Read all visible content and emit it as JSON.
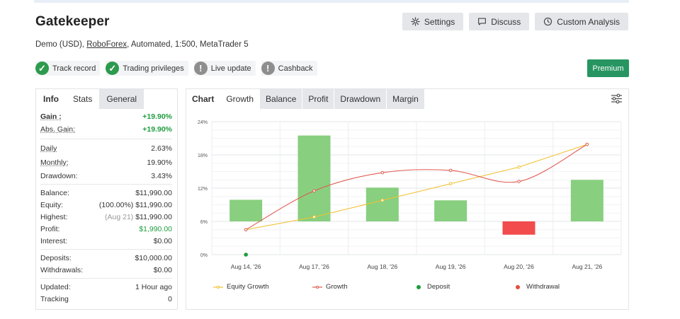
{
  "header": {
    "title": "Gatekeeper",
    "buttons": {
      "settings": "Settings",
      "discuss": "Discuss",
      "custom_analysis": "Custom Analysis"
    },
    "subtitle": {
      "prefix": "Demo (USD), ",
      "broker": "RoboForex",
      "suffix": ", Automated, 1:500, MetaTrader 5"
    }
  },
  "badges": [
    {
      "label": "Track record",
      "status": "ok",
      "icon": "check-icon"
    },
    {
      "label": "Trading privileges",
      "status": "ok",
      "icon": "check-icon"
    },
    {
      "label": "Live update",
      "status": "warn",
      "icon": "exclamation-icon"
    },
    {
      "label": "Cashback",
      "status": "warn",
      "icon": "exclamation-icon"
    }
  ],
  "premium_label": "Premium",
  "left_panel": {
    "tabs": [
      "Info",
      "Stats",
      "General"
    ],
    "stats": {
      "gain": {
        "label": "Gain :",
        "value": "+19.90%"
      },
      "abs_gain": {
        "label": "Abs. Gain:",
        "value": "+19.90%"
      },
      "daily": {
        "label": "Daily",
        "value": "2.63%"
      },
      "monthly": {
        "label": "Monthly:",
        "value": "19.90%"
      },
      "drawdown": {
        "label": "Drawdown:",
        "value": "3.43%"
      },
      "balance": {
        "label": "Balance:",
        "value": "$11,990.00"
      },
      "equity": {
        "label": "Equity:",
        "note": "(100.00%)",
        "value": "$11,990.00"
      },
      "highest": {
        "label": "Highest:",
        "note": "(Aug 21)",
        "value": "$11,990.00"
      },
      "profit": {
        "label": "Profit:",
        "value": "$1,990.00"
      },
      "interest": {
        "label": "Interest:",
        "value": "$0.00"
      },
      "deposits": {
        "label": "Deposits:",
        "value": "$10,000.00"
      },
      "withdrawals": {
        "label": "Withdrawals:",
        "value": "$0.00"
      },
      "updated": {
        "label": "Updated:",
        "value": "1 Hour ago"
      },
      "tracking": {
        "label": "Tracking",
        "value": "0"
      }
    }
  },
  "right_panel": {
    "tabs": [
      "Chart",
      "Growth",
      "Balance",
      "Profit",
      "Drawdown",
      "Margin"
    ]
  },
  "colors": {
    "bar_up": "#88cf7f",
    "bar_down": "#f24c4c",
    "growth_line": "#e05a4f",
    "equity_line": "#f1c232",
    "deposit": "#1d9e3b",
    "withdrawal": "#e74c3c",
    "accent_green": "#279561"
  },
  "chart_data": {
    "type": "bar",
    "categories": [
      "Aug 14, '26",
      "Aug 17, '26",
      "Aug 18, '26",
      "Aug 19, '26",
      "Aug 20, '26",
      "Aug 21, '26"
    ],
    "yticks": [
      "0%",
      "6%",
      "12%",
      "18%",
      "24%"
    ],
    "ylim": [
      0,
      24
    ],
    "bar_baseline": 6,
    "series": [
      {
        "name": "Equity Growth",
        "kind": "line",
        "values": [
          4.5,
          6.8,
          9.8,
          12.8,
          15.8,
          19.9
        ]
      },
      {
        "name": "Growth",
        "kind": "line",
        "values": [
          4.5,
          11.5,
          14.8,
          15.2,
          13.2,
          19.9
        ]
      },
      {
        "name": "Growth",
        "kind": "bar",
        "values": [
          3.9,
          15.5,
          6.1,
          3.8,
          -2.4,
          7.5
        ]
      },
      {
        "name": "Deposit",
        "kind": "point",
        "values": [
          0,
          null,
          null,
          null,
          null,
          null
        ]
      },
      {
        "name": "Withdrawal",
        "kind": "point",
        "values": [
          null,
          null,
          null,
          null,
          null,
          null
        ]
      }
    ],
    "legend": [
      "Equity Growth",
      "Growth",
      "Deposit",
      "Withdrawal"
    ],
    "legend_position": "bottom",
    "grid": true
  }
}
